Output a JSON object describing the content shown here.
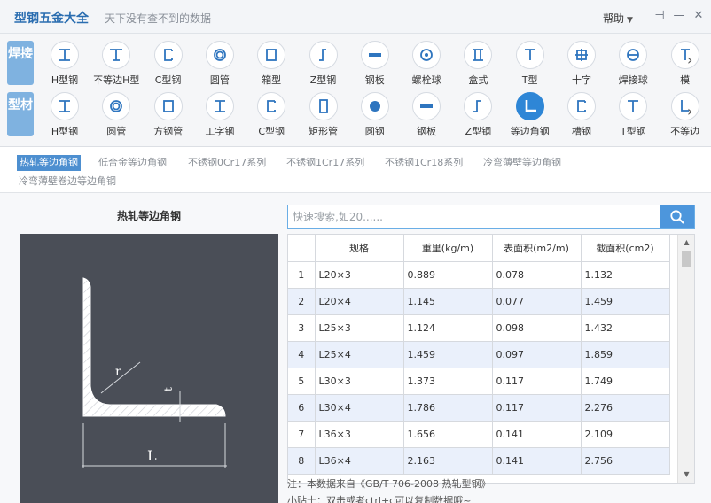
{
  "app": {
    "title": "型钢五金大全",
    "subtitle": "天下没有查不到的数据",
    "help_label": "帮助"
  },
  "categories": {
    "row1_label": "焊接",
    "row2_label": "型材",
    "row1": [
      "H型钢",
      "不等边H型",
      "C型钢",
      "圆管",
      "箱型",
      "Z型钢",
      "钢板",
      "螺栓球",
      "盒式",
      "T型",
      "十字",
      "焊接球",
      "模"
    ],
    "row2": [
      "H型钢",
      "圆管",
      "方钢管",
      "工字钢",
      "C型钢",
      "矩形管",
      "圆钢",
      "钢板",
      "Z型钢",
      "等边角钢",
      "槽钢",
      "T型钢",
      "不等边"
    ]
  },
  "subtabs": [
    "热轧等边角钢",
    "低合金等边角钢",
    "不锈钢0Cr17系列",
    "不锈钢1Cr17系列",
    "不锈钢1Cr18系列",
    "冷弯薄壁等边角钢",
    "冷弯薄壁卷边等边角钢"
  ],
  "section_title": "热轧等边角钢",
  "diagram": {
    "r": "r",
    "t": "t",
    "L": "L"
  },
  "search": {
    "placeholder": "快速搜索,如20......"
  },
  "table": {
    "headers": [
      "规格",
      "重里(kg/m)",
      "表面积(m2/m)",
      "截面积(cm2)"
    ],
    "rows": [
      [
        "1",
        "L20×3",
        "0.889",
        "0.078",
        "1.132"
      ],
      [
        "2",
        "L20×4",
        "1.145",
        "0.077",
        "1.459"
      ],
      [
        "3",
        "L25×3",
        "1.124",
        "0.098",
        "1.432"
      ],
      [
        "4",
        "L25×4",
        "1.459",
        "0.097",
        "1.859"
      ],
      [
        "5",
        "L30×3",
        "1.373",
        "0.117",
        "1.749"
      ],
      [
        "6",
        "L30×4",
        "1.786",
        "0.117",
        "2.276"
      ],
      [
        "7",
        "L36×3",
        "1.656",
        "0.141",
        "2.109"
      ],
      [
        "8",
        "L36×4",
        "2.163",
        "0.141",
        "2.756"
      ]
    ]
  },
  "note": "注：本数据来自《GB/T  706-2008  热轧型钢》",
  "tip": "小贴士：双击或者ctrl+c可以复制数据哦~",
  "colors": {
    "accent": "#2e86d6",
    "row_alt": "#eaf0fb",
    "diagram_bg": "#4a4e57"
  }
}
